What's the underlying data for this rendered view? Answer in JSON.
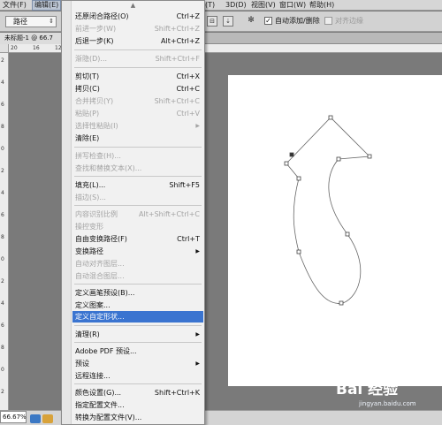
{
  "menubar": {
    "items": [
      {
        "label": "文件(F)"
      },
      {
        "label": "编辑(E)"
      },
      {
        "label": "(T)"
      },
      {
        "label": "3D(D)"
      },
      {
        "label": "视图(V)"
      },
      {
        "label": "窗口(W)"
      },
      {
        "label": "帮助(H)"
      }
    ]
  },
  "options_bar": {
    "path_select": "路径",
    "auto_add_delete_label": "自动添加/删除",
    "auto_add_delete_checked": true,
    "align_edges_label": "对齐边缘",
    "align_edges_checked": false
  },
  "document": {
    "tab_title": "未标题-1 @ 66.7"
  },
  "ruler": {
    "top_labels": [
      "20",
      "16",
      "12"
    ],
    "left_labels": [
      "2",
      "4",
      "6",
      "8",
      "0",
      "2",
      "4",
      "6",
      "8",
      "0",
      "2",
      "4",
      "6",
      "8",
      "0",
      "2"
    ]
  },
  "status": {
    "zoom": "66.67%"
  },
  "edit_menu": {
    "items": [
      {
        "label": "还原闭合路径(O)",
        "shortcut": "Ctrl+Z",
        "disabled": false
      },
      {
        "label": "前进一步(W)",
        "shortcut": "Shift+Ctrl+Z",
        "disabled": true
      },
      {
        "label": "后退一步(K)",
        "shortcut": "Alt+Ctrl+Z",
        "disabled": false
      },
      {
        "label": "渐隐(D)...",
        "shortcut": "Shift+Ctrl+F",
        "disabled": true
      },
      {
        "label": "剪切(T)",
        "shortcut": "Ctrl+X",
        "disabled": false
      },
      {
        "label": "拷贝(C)",
        "shortcut": "Ctrl+C",
        "disabled": false
      },
      {
        "label": "合并拷贝(Y)",
        "shortcut": "Shift+Ctrl+C",
        "disabled": true
      },
      {
        "label": "粘贴(P)",
        "shortcut": "Ctrl+V",
        "disabled": true
      },
      {
        "label": "选择性粘贴(I)",
        "shortcut": "",
        "disabled": true,
        "submenu": true
      },
      {
        "label": "清除(E)",
        "shortcut": "",
        "disabled": false
      },
      {
        "label": "拼写检查(H)...",
        "shortcut": "",
        "disabled": true
      },
      {
        "label": "查找和替换文本(X)...",
        "shortcut": "",
        "disabled": true
      },
      {
        "label": "填充(L)...",
        "shortcut": "Shift+F5",
        "disabled": false
      },
      {
        "label": "描边(S)...",
        "shortcut": "",
        "disabled": true
      },
      {
        "label": "内容识别比例",
        "shortcut": "Alt+Shift+Ctrl+C",
        "disabled": true
      },
      {
        "label": "操控变形",
        "shortcut": "",
        "disabled": true
      },
      {
        "label": "自由变换路径(F)",
        "shortcut": "Ctrl+T",
        "disabled": false
      },
      {
        "label": "变换路径",
        "shortcut": "",
        "disabled": false,
        "submenu": true
      },
      {
        "label": "自动对齐图层...",
        "shortcut": "",
        "disabled": true
      },
      {
        "label": "自动混合图层...",
        "shortcut": "",
        "disabled": true
      },
      {
        "label": "定义画笔预设(B)...",
        "shortcut": "",
        "disabled": false
      },
      {
        "label": "定义图案...",
        "shortcut": "",
        "disabled": false
      },
      {
        "label": "定义自定形状...",
        "shortcut": "",
        "disabled": false,
        "highlighted": true
      },
      {
        "label": "清理(R)",
        "shortcut": "",
        "disabled": false,
        "submenu": true
      },
      {
        "label": "Adobe PDF 预设...",
        "shortcut": "",
        "disabled": false
      },
      {
        "label": "预设",
        "shortcut": "",
        "disabled": false,
        "submenu": true
      },
      {
        "label": "远程连接...",
        "shortcut": "",
        "disabled": false
      },
      {
        "label": "颜色设置(G)...",
        "shortcut": "Shift+Ctrl+K",
        "disabled": false
      },
      {
        "label": "指定配置文件...",
        "shortcut": "",
        "disabled": false
      },
      {
        "label": "转换为配置文件(V)...",
        "shortcut": "",
        "disabled": false
      }
    ],
    "submenu_arrow": "▶",
    "scroll_up": "▲"
  },
  "watermark": {
    "text": "Bai 经验",
    "sub": "jingyan.baidu.com"
  },
  "colors": {
    "highlight": "#3a74d0",
    "menu_bg": "#f1f1f1",
    "workspace": "#7a7a7a"
  }
}
